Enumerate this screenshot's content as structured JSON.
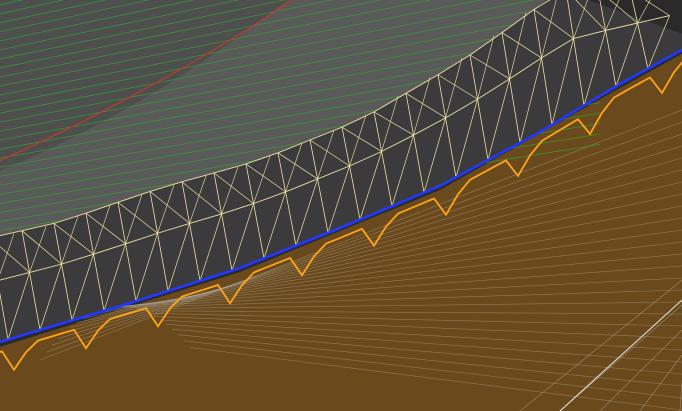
{
  "viewport": {
    "view": "3d-mesh-perspective",
    "texts": []
  },
  "layers": {
    "upper_surface": {
      "color": "#5a5a5a",
      "line_color": "#2fa22f",
      "edge_color": "#c0392b"
    },
    "ground_plane": {
      "color": "#6a4a1c",
      "line_color": "#b8b8b8"
    },
    "mesh_strip": {
      "face_color": "#3b3b3d",
      "wire_color": "#f2dfa0"
    },
    "boundaries": {
      "blue_color": "#2238ff",
      "orange_color": "#ffa41a"
    }
  }
}
